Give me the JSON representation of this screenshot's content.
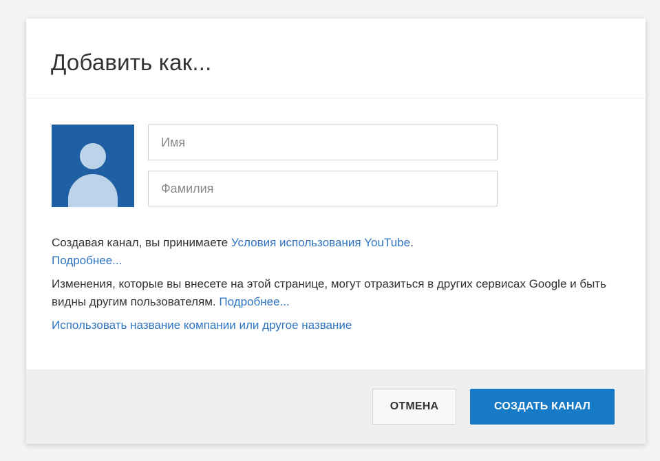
{
  "dialog": {
    "title": "Добавить как..."
  },
  "form": {
    "first_name": {
      "placeholder": "Имя",
      "value": ""
    },
    "last_name": {
      "placeholder": "Фамилия",
      "value": ""
    }
  },
  "info": {
    "terms_prefix": "Создавая канал, вы принимаете ",
    "terms_link": "Условия использования YouTube",
    "terms_suffix": ".",
    "terms_more_link": "Подробнее...",
    "changes_text": "Изменения, которые вы внесете на этой странице, могут отразиться в других сервисах Google и быть видны другим пользователям. ",
    "changes_more_link": "Подробнее...",
    "use_business_link": "Использовать название компании или другое название"
  },
  "buttons": {
    "cancel": "Отмена",
    "create": "Создать канал"
  },
  "colors": {
    "avatar_bg": "#1f5fa3",
    "avatar_fg": "#bcd3ea",
    "link": "#2f74c0",
    "primary_button": "#167ac6"
  },
  "icons": {
    "avatar": "default-user-avatar-icon"
  }
}
